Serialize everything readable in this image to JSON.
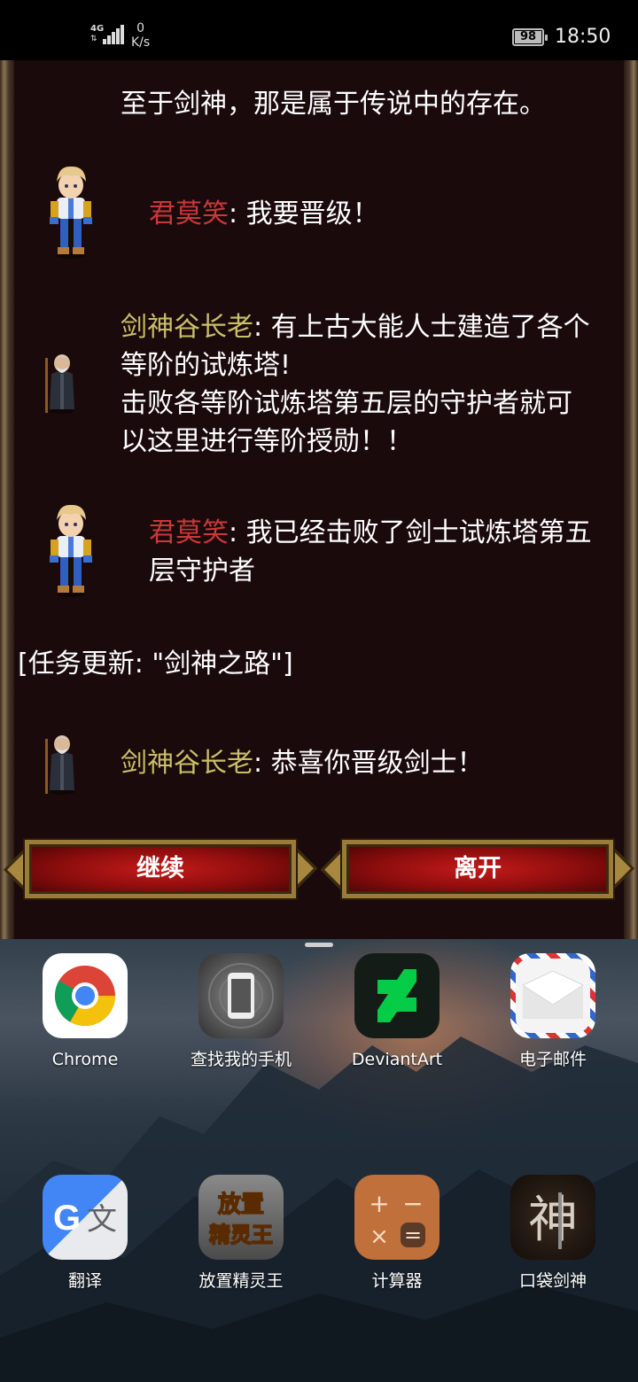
{
  "status_bar": {
    "network": "4G",
    "speed_value": "0",
    "speed_unit": "K/s",
    "battery": "98",
    "time": "18:50"
  },
  "dialogue": {
    "line0": {
      "text": "至于剑神，那是属于传说中的存在。"
    },
    "line1": {
      "speaker": "君莫笑",
      "text": ": 我要晋级！"
    },
    "line2": {
      "speaker": "剑神谷长老",
      "text": ": 有上古大能人士建造了各个",
      "rest": [
        "等阶的试炼塔!",
        "击败各等阶试炼塔第五层的守护者就可",
        "以这里进行等阶授勋！！"
      ]
    },
    "line3": {
      "speaker": "君莫笑",
      "text": ": 我已经击败了剑士试炼塔第五",
      "rest": [
        "层守护者"
      ]
    },
    "line4": {
      "text": "[任务更新: \"剑神之路\"]"
    },
    "line5": {
      "speaker": "剑神谷长老",
      "text": ": 恭喜你晋级剑士！"
    }
  },
  "buttons": {
    "continue": "继续",
    "leave": "离开"
  },
  "colors": {
    "speaker_player": "#c9383a",
    "speaker_elder": "#c9c068",
    "panel_bg": "#1b0a0b"
  },
  "apps": [
    {
      "label": "Chrome",
      "icon": "chrome-icon"
    },
    {
      "label": "查找我的手机",
      "icon": "find-my-phone-icon"
    },
    {
      "label": "DeviantArt",
      "icon": "deviantart-icon"
    },
    {
      "label": "电子邮件",
      "icon": "email-icon"
    },
    {
      "label": "翻译",
      "icon": "translate-icon"
    },
    {
      "label": "放置精灵王",
      "icon": "idle-elf-king-icon",
      "icon_text": [
        "放置",
        "精灵王"
      ]
    },
    {
      "label": "计算器",
      "icon": "calculator-icon"
    },
    {
      "label": "口袋剑神",
      "icon": "pocket-sword-god-icon",
      "icon_text": "神"
    }
  ]
}
